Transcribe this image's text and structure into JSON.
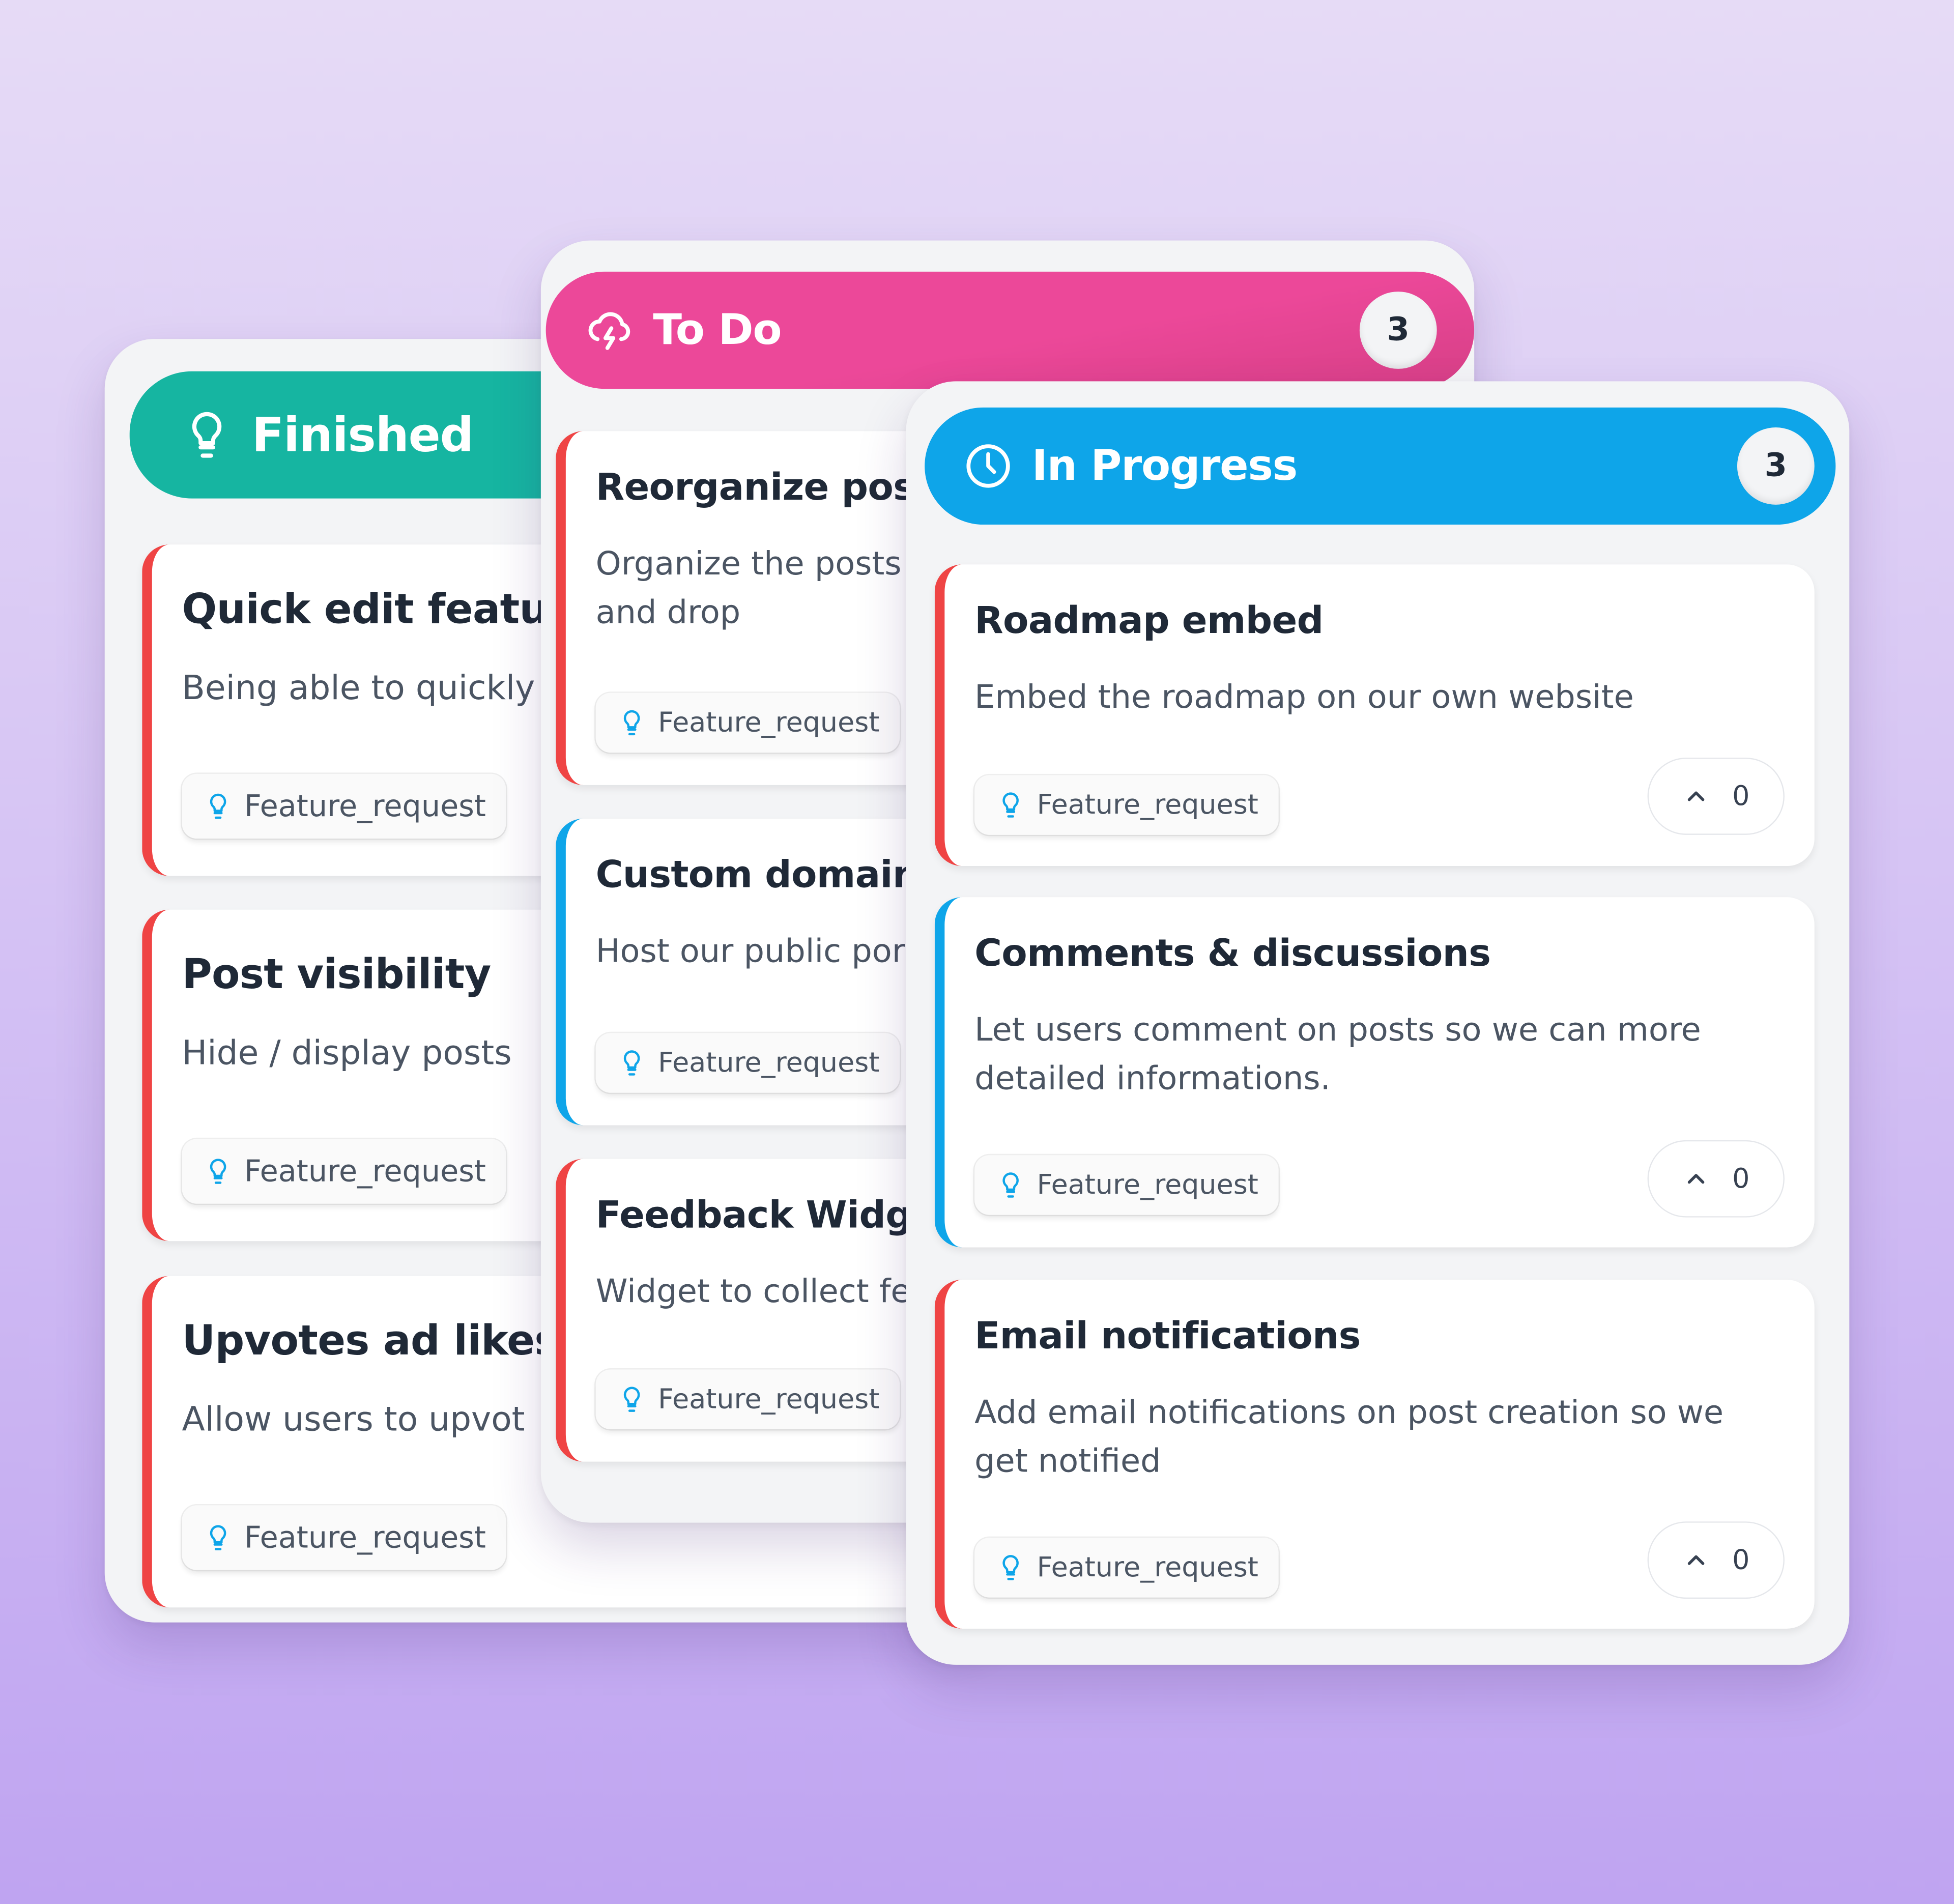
{
  "colors": {
    "finished": "#16b5a1",
    "todo": "#ec4899",
    "in_progress": "#0ea5e9",
    "card_border_red": "#ef4444",
    "card_border_blue": "#0ea5e9",
    "tag_icon": "#0ea5e9"
  },
  "columns": [
    {
      "id": "finished",
      "title": "Finished",
      "icon": "lightbulb-icon",
      "cards": [
        {
          "title": "Quick edit feature",
          "description": "Being able to quickly",
          "tag": "Feature_request",
          "accent": "red"
        },
        {
          "title": "Post visibility",
          "description": "Hide / display posts",
          "tag": "Feature_request",
          "accent": "red"
        },
        {
          "title": "Upvotes ad likes",
          "description": "Allow users to upvot",
          "tag": "Feature_request",
          "accent": "red"
        }
      ]
    },
    {
      "id": "todo",
      "title": "To Do",
      "icon": "cloud-lightning-icon",
      "count": "3",
      "cards": [
        {
          "title": "Reorganize post",
          "description": "Organize the posts and drop",
          "tag": "Feature_request",
          "accent": "red"
        },
        {
          "title": "Custom domain",
          "description": "Host our public por",
          "tag": "Feature_request",
          "accent": "blue"
        },
        {
          "title": "Feedback Widge",
          "description": "Widget to collect fe",
          "tag": "Feature_request",
          "accent": "red"
        }
      ]
    },
    {
      "id": "in_progress",
      "title": "In Progress",
      "icon": "clock-icon",
      "count": "3",
      "cards": [
        {
          "title": "Roadmap embed",
          "description": "Embed the roadmap on our own website",
          "tag": "Feature_request",
          "votes": "0",
          "accent": "red"
        },
        {
          "title": "Comments & discussions",
          "description": "Let users comment on posts so we can more detailed informations.",
          "tag": "Feature_request",
          "votes": "0",
          "accent": "blue"
        },
        {
          "title": "Email notifications",
          "description": "Add email notifications on post creation so we get notified",
          "tag": "Feature_request",
          "votes": "0",
          "accent": "red"
        }
      ]
    }
  ]
}
